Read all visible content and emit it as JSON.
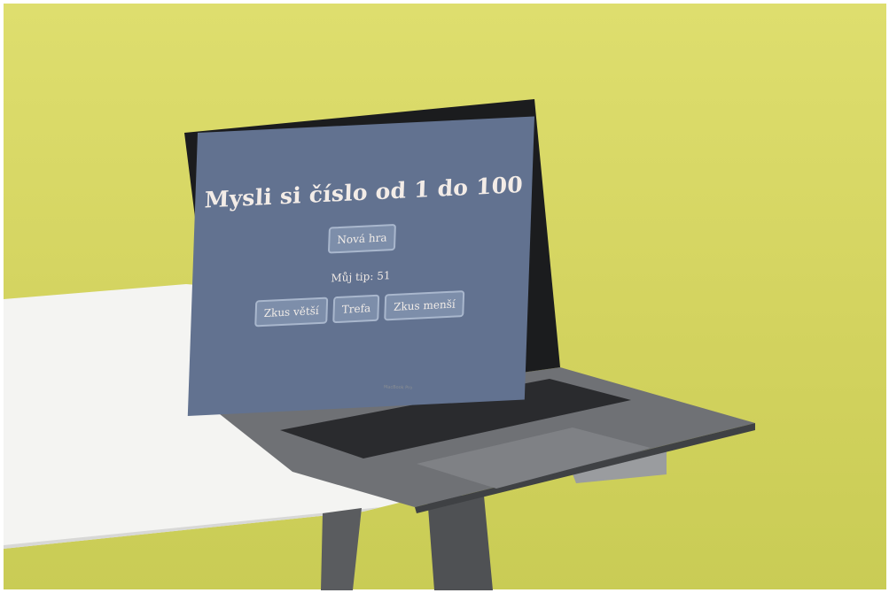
{
  "app": {
    "title": "Mysli si číslo od 1 do 100",
    "new_game_label": "Nová hra",
    "guess_label": "Můj tip:",
    "guess_value": "51",
    "buttons": {
      "higher": "Zkus větší",
      "correct": "Trefa",
      "lower": "Zkus menší"
    }
  },
  "device": {
    "brand": "MacBook Pro"
  },
  "colors": {
    "screen_bg": "#627290",
    "button_bg": "#7d8eaa",
    "button_border": "#a9b7cd",
    "text": "#f3ece7",
    "wall": "#dede6e"
  }
}
